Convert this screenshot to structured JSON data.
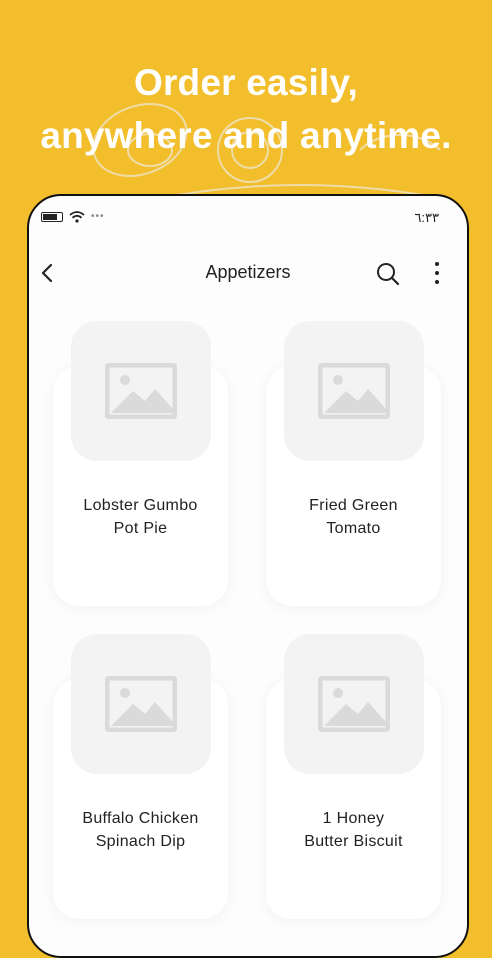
{
  "headline": {
    "line1": "Order easily,",
    "line2": "anywhere and anytime."
  },
  "status_bar": {
    "time": "٦:٣٣",
    "icons": [
      "battery-icon",
      "wifi-icon",
      "signal-dots-icon"
    ]
  },
  "app_bar": {
    "title": "Appetizers",
    "icons": [
      "back-arrow-icon",
      "search-icon",
      "more-vert-icon"
    ]
  },
  "items": [
    {
      "line1": "Lobster Gumbo",
      "line2": "Pot Pie"
    },
    {
      "line1": "Fried  Green",
      "line2": "Tomato"
    },
    {
      "line1": "Buffalo Chicken",
      "line2": "Spinach Dip"
    },
    {
      "line1": "1 Honey",
      "line2": "Butter Biscuit"
    }
  ],
  "colors": {
    "background": "#F3BE2B",
    "headline_text": "#FFFFFF",
    "screen": "#FDFDFD",
    "placeholder": "#F3F3F3",
    "placeholder_icon": "#DADADA"
  }
}
